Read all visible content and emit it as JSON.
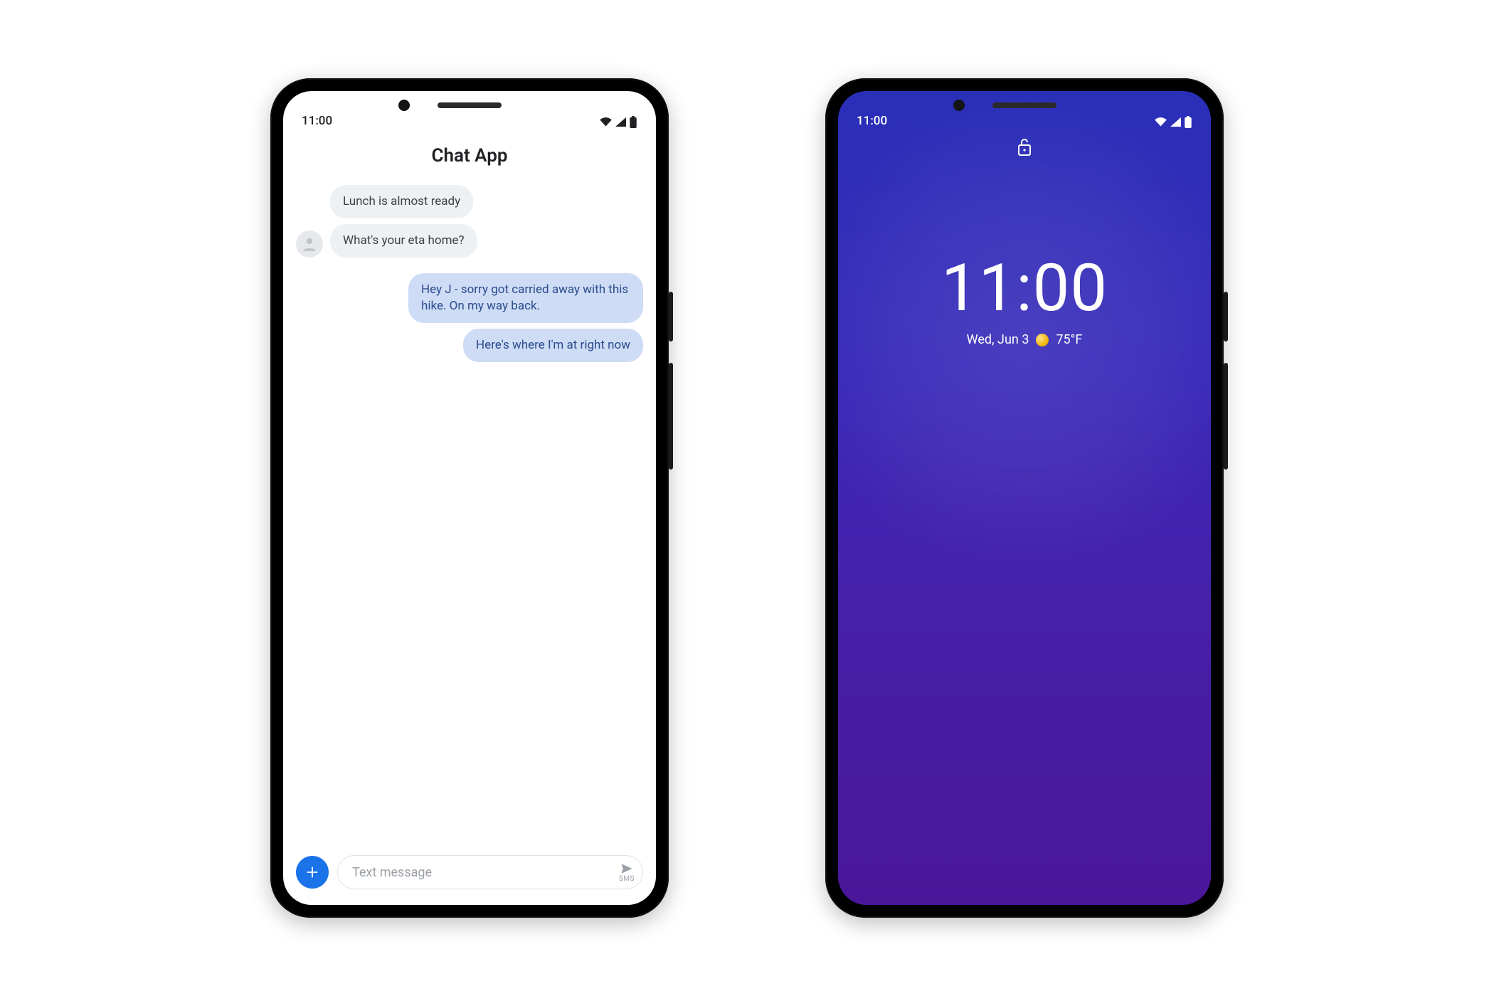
{
  "phoneA": {
    "status_time": "11:00",
    "app_title": "Chat App",
    "messages": [
      {
        "dir": "in",
        "text": "Lunch is almost ready"
      },
      {
        "dir": "in",
        "text": "What's your eta home?"
      },
      {
        "dir": "out",
        "text": "Hey J - sorry got carried away with this hike. On my way back."
      },
      {
        "dir": "out",
        "text": "Here's where I'm at right now"
      }
    ],
    "composer": {
      "placeholder": "Text message",
      "send_label": "SMS"
    }
  },
  "phoneB": {
    "status_time": "11:00",
    "clock": "11:00",
    "date": "Wed, Jun 3",
    "temp": "75°F",
    "weather_icon": "sunny"
  }
}
